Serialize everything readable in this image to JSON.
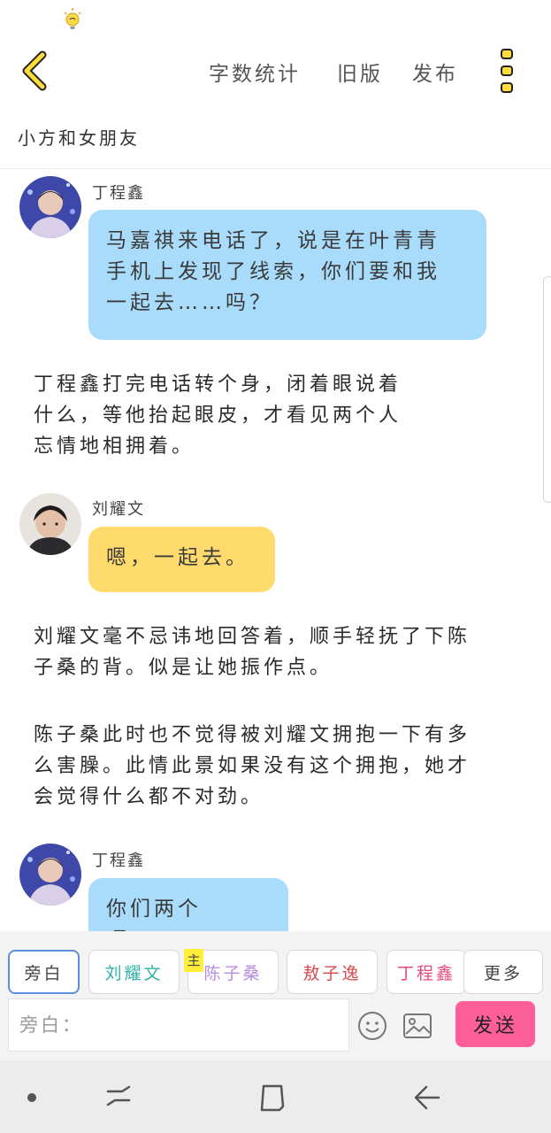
{
  "icons": {
    "status": "lightbulb-notification-icon",
    "back": "chevron-left-icon",
    "menu": "more-vertical-icon",
    "emoji": "smiley-icon",
    "image": "image-icon",
    "nav_dot": "dot-icon",
    "nav_recent": "recent-apps-icon",
    "nav_home": "home-icon",
    "nav_back": "back-arrow-icon"
  },
  "colors": {
    "accent_yellow": "#ffdb6e",
    "bubble_blue": "#a9dcfb",
    "send_pink": "#ff5f98",
    "chip_active_border": "#5f8fd8",
    "main_tag": "#ffee3c"
  },
  "top_bar": {
    "word_count": "字数统计",
    "old_version": "旧版",
    "publish": "发布"
  },
  "story": {
    "title": "小方和女朋友"
  },
  "messages": {
    "m1": {
      "speaker": "丁程鑫",
      "lines": [
        "马嘉祺来电话了，说是在叶青青",
        "手机上发现了线索，你们要和我",
        "一起去……吗？"
      ]
    },
    "n1": {
      "lines": [
        "丁程鑫打完电话转个身，闭着眼说着",
        "什么，等他抬起眼皮，才看见两个人",
        "忘情地相拥着。"
      ]
    },
    "m2": {
      "speaker": "刘耀文",
      "lines": [
        "嗯，一起去。"
      ]
    },
    "n2": {
      "lines": [
        "刘耀文毫不忌讳地回答着，顺手轻抚了下陈",
        "子桑的背。似是让她振作点。"
      ]
    },
    "n3": {
      "lines": [
        "陈子桑此时也不觉得被刘耀文拥抱一下有多",
        "么害臊。此情此景如果没有这个拥抱，她才",
        "会觉得什么都不对劲。"
      ]
    },
    "m3": {
      "speaker": "丁程鑫",
      "lines": [
        "你们两个呀……"
      ]
    }
  },
  "roles": {
    "narration": "旁白",
    "liu": "刘耀文",
    "chen": "陈子桑",
    "ao": "敖子逸",
    "ding": "丁程鑫",
    "more": "更多",
    "main_tag": "主"
  },
  "input": {
    "placeholder": "旁白：",
    "value": ""
  },
  "send_label": "发送"
}
